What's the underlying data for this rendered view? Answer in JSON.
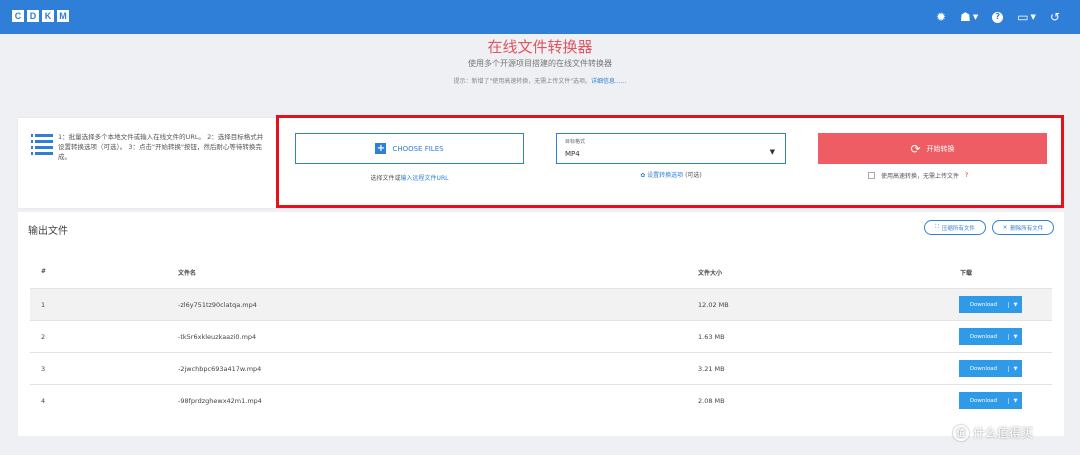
{
  "header": {
    "logo_letters": [
      "C",
      "D",
      "K",
      "M"
    ],
    "icons": [
      "settings-icon",
      "user-icon",
      "help-icon",
      "language-icon",
      "history-icon"
    ]
  },
  "page": {
    "title": "在线文件转换器",
    "subtitle": "使用多个开源项目搭建的在线文件转换器",
    "tip_prefix": "提示：新增了\"使用高速转换，无需上传文件\"选项。",
    "tip_link": "详细信息......"
  },
  "instructions": "1：批量选择多个本地文件或输入在线文件的URL。 2：选择目标格式并设置转换选项（可选）。 3：点击\"开始转换\"按钮，然后耐心等待转换完成。",
  "upload": {
    "choose_label": "CHOOSE FILES",
    "hint_prefix": "选择文件或",
    "hint_link": "输入远程文件URL"
  },
  "format": {
    "label": "目标格式",
    "value": "MP4",
    "advanced_link": "设置转换选项",
    "advanced_suffix": "(可选)"
  },
  "convert": {
    "start_label": "开始转换",
    "parallel_label": "使用高速转换，无需上传文件",
    "parallel_mark": "?"
  },
  "output": {
    "title": "输出文件",
    "clear_button": "压缩所有文件",
    "delete_button": "删除所有文件",
    "columns": {
      "index": "#",
      "name": "文件名",
      "size": "文件大小",
      "download": "下载"
    },
    "rows": [
      {
        "index": "1",
        "name": "-zl6y751tz90clatqa.mp4",
        "size": "12.02 MB",
        "download": "Download"
      },
      {
        "index": "2",
        "name": "-tk5r6xkleuzkaazi0.mp4",
        "size": "1.63 MB",
        "download": "Download"
      },
      {
        "index": "3",
        "name": "-2jwchbpc693a417w.mp4",
        "size": "3.21 MB",
        "download": "Download"
      },
      {
        "index": "4",
        "name": "-98fprdzghewx42m1.mp4",
        "size": "2.08 MB",
        "download": "Download"
      }
    ]
  },
  "watermark": {
    "icon_text": "值",
    "text": "什么值得买"
  },
  "colors": {
    "topbar": "#2f7fd8",
    "accent": "#2f7fd8",
    "start": "#ee5d63",
    "highlight_box": "#e3121c"
  }
}
